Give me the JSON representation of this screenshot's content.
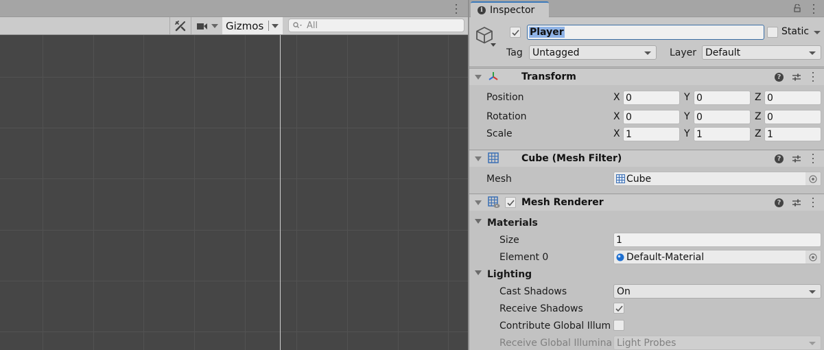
{
  "scene": {
    "toolbar": {
      "tools_icon": "tools-icon",
      "camera_icon": "camera-icon",
      "gizmos_label": "Gizmos",
      "search_placeholder": "All"
    }
  },
  "inspector": {
    "tab_label": "Inspector",
    "gameobject": {
      "active": true,
      "name": "Player",
      "static_label": "Static",
      "static": false,
      "tag_label": "Tag",
      "tag_value": "Untagged",
      "layer_label": "Layer",
      "layer_value": "Default"
    },
    "transform": {
      "title": "Transform",
      "rows": [
        {
          "label": "Position",
          "x": "0",
          "y": "0",
          "z": "0"
        },
        {
          "label": "Rotation",
          "x": "0",
          "y": "0",
          "z": "0"
        },
        {
          "label": "Scale",
          "x": "1",
          "y": "1",
          "z": "1"
        }
      ],
      "axis_labels": [
        "X",
        "Y",
        "Z"
      ]
    },
    "mesh_filter": {
      "title": "Cube (Mesh Filter)",
      "mesh_label": "Mesh",
      "mesh_value": "Cube"
    },
    "mesh_renderer": {
      "title": "Mesh Renderer",
      "enabled": true,
      "materials_label": "Materials",
      "size_label": "Size",
      "size_value": "1",
      "element0_label": "Element 0",
      "element0_value": "Default-Material",
      "lighting_label": "Lighting",
      "cast_shadows_label": "Cast Shadows",
      "cast_shadows_value": "On",
      "receive_shadows_label": "Receive Shadows",
      "receive_shadows": true,
      "contribute_gi_label": "Contribute Global Illum",
      "contribute_gi": false,
      "receive_gi_label": "Receive Global Illumina",
      "receive_gi_value": "Light Probes"
    }
  }
}
